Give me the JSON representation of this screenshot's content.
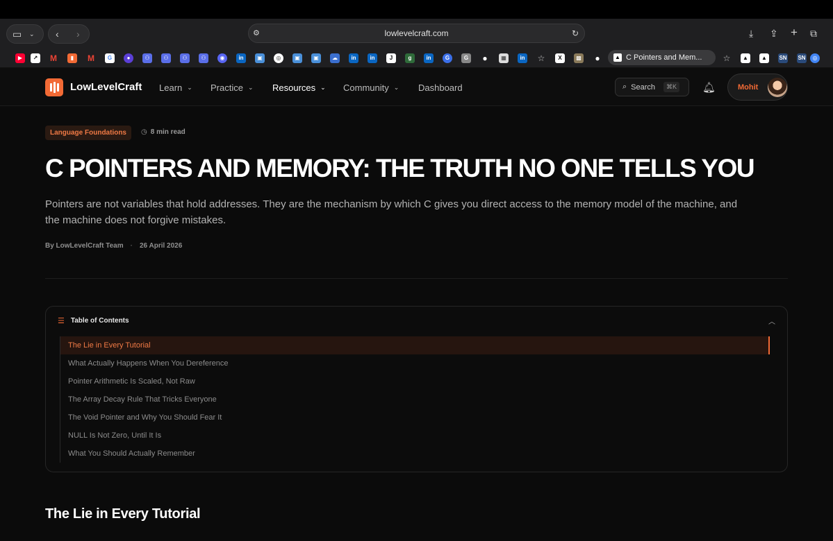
{
  "browser": {
    "url": "lowlevelcraft.com",
    "active_tab_title": "C Pointers and Mem...",
    "favorites": [
      "youtube",
      "arrow",
      "gmail",
      "bookmark",
      "gmail",
      "google",
      "app",
      "teams",
      "teams",
      "teams",
      "teams",
      "discord",
      "linkedin",
      "app",
      "chrome",
      "app",
      "app",
      "teams",
      "linkedin",
      "linkedin",
      "app",
      "app",
      "linkedin",
      "app",
      "app",
      "github",
      "app",
      "linkedin",
      "star",
      "x",
      "app",
      "github"
    ]
  },
  "site": {
    "brand": "LowLevelCraft",
    "nav": [
      "Learn",
      "Practice",
      "Resources",
      "Community",
      "Dashboard"
    ],
    "search_label": "Search",
    "search_shortcut": "⌘K",
    "user_name": "Mohit",
    "accent": "#f26a35"
  },
  "article": {
    "tag": "Language Foundations",
    "read_time": "8 min read",
    "title": "C POINTERS AND MEMORY: THE TRUTH NO ONE TELLS YOU",
    "lede": "Pointers are not variables that hold addresses. They are the mechanism by which C gives you direct access to the memory model of the machine, and the machine does not forgive mistakes.",
    "author": "By LowLevelCraft Team",
    "separator": "·",
    "date": "26 April 2026",
    "toc_title": "Table of Contents",
    "toc": [
      "The Lie in Every Tutorial",
      "What Actually Happens When You Dereference",
      "Pointer Arithmetic Is Scaled, Not Raw",
      "The Array Decay Rule That Tricks Everyone",
      "The Void Pointer and Why You Should Fear It",
      "NULL Is Not Zero, Until It Is",
      "What You Should Actually Remember"
    ],
    "section_heading": "The Lie in Every Tutorial"
  }
}
